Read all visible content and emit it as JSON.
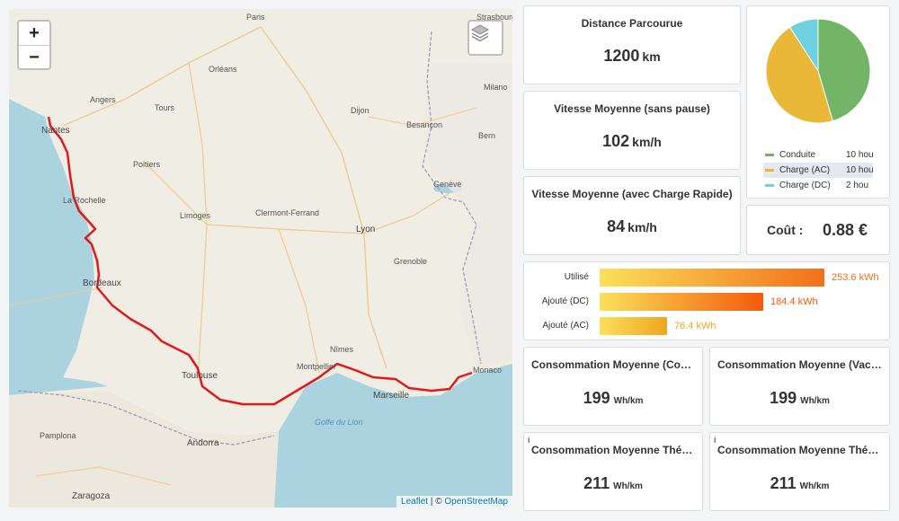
{
  "map": {
    "zoom_in": "+",
    "zoom_out": "−",
    "attribution_leaflet": "Leaflet",
    "attribution_sep": " | © ",
    "attribution_osm": "OpenStreetMap",
    "route_color": "#e01a1a",
    "labels": {
      "nantes": "Nantes",
      "la_rochelle": "La Rochelle",
      "bordeaux": "Bordeaux",
      "toulouse": "Toulouse",
      "montpellier": "Montpellier",
      "nimes": "Nîmes",
      "marseille": "Marseille",
      "monaco": "Monaco",
      "lyon": "Lyon",
      "paris": "Paris",
      "strasbourg": "Strasbourg",
      "bern": "Bern",
      "geneve": "Genève",
      "milano": "Milano",
      "limoges": "Limoges",
      "clermont": "Clermont-Ferrand",
      "grenoble": "Grenoble",
      "andorra": "Andorra",
      "zaragoza": "Zaragoza",
      "gulf": "Golfe du Lion",
      "poitiers": "Poitiers",
      "tours": "Tours",
      "angers": "Angers",
      "orleans": "Orléans",
      "dijon": "Dijon",
      "besancon": "Besançon",
      "pamplona": "Pamplona"
    }
  },
  "distance": {
    "title": "Distance Parcourue",
    "value": "1200",
    "unit": "km"
  },
  "pie": {
    "legend": [
      {
        "label": "Conduite",
        "value": "10 hou",
        "color": "#73b566"
      },
      {
        "label": "Charge (AC)",
        "value": "10 hou",
        "color": "#eab839"
      },
      {
        "label": "Charge (DC)",
        "value": "2 hou",
        "color": "#6ed0e0"
      }
    ],
    "slices": [
      {
        "label": "Conduite",
        "fraction": 0.4545,
        "color": "#73b566"
      },
      {
        "label": "Charge (AC)",
        "fraction": 0.4545,
        "color": "#eab839"
      },
      {
        "label": "Charge (DC)",
        "fraction": 0.0909,
        "color": "#6ed0e0"
      }
    ]
  },
  "speed_no_pause": {
    "title": "Vitesse Moyenne (sans pause)",
    "value": "102",
    "unit": "km/h"
  },
  "speed_with_charge": {
    "title": "Vitesse Moyenne (avec Charge Rapide)",
    "value": "84",
    "unit": "km/h"
  },
  "cost": {
    "label": "Coût :",
    "value": "0.88 €"
  },
  "energy": {
    "max": 253.6,
    "rows": [
      {
        "label": "Utilisé",
        "value": 253.6,
        "text": "253.6 kWh",
        "color": "#f2701a"
      },
      {
        "label": "Ajouté (DC)",
        "value": 184.4,
        "text": "184.4 kWh",
        "color": "#f45a0c"
      },
      {
        "label": "Ajouté (AC)",
        "value": 76.4,
        "text": "76.4 kWh",
        "color": "#eea51f"
      }
    ]
  },
  "cons1": {
    "title": "Consommation Moyenne (Conduite)",
    "value": "199",
    "unit": "Wh/km"
  },
  "cons2": {
    "title": "Consommation Moyenne (Vacances)",
    "value": "199",
    "unit": "Wh/km"
  },
  "cons3": {
    "title": "Consommation Moyenne Théorique",
    "value": "211",
    "unit": "Wh/km",
    "info": "i"
  },
  "cons4": {
    "title": "Consommation Moyenne Théorique",
    "value": "211",
    "unit": "Wh/km",
    "info": "i"
  }
}
